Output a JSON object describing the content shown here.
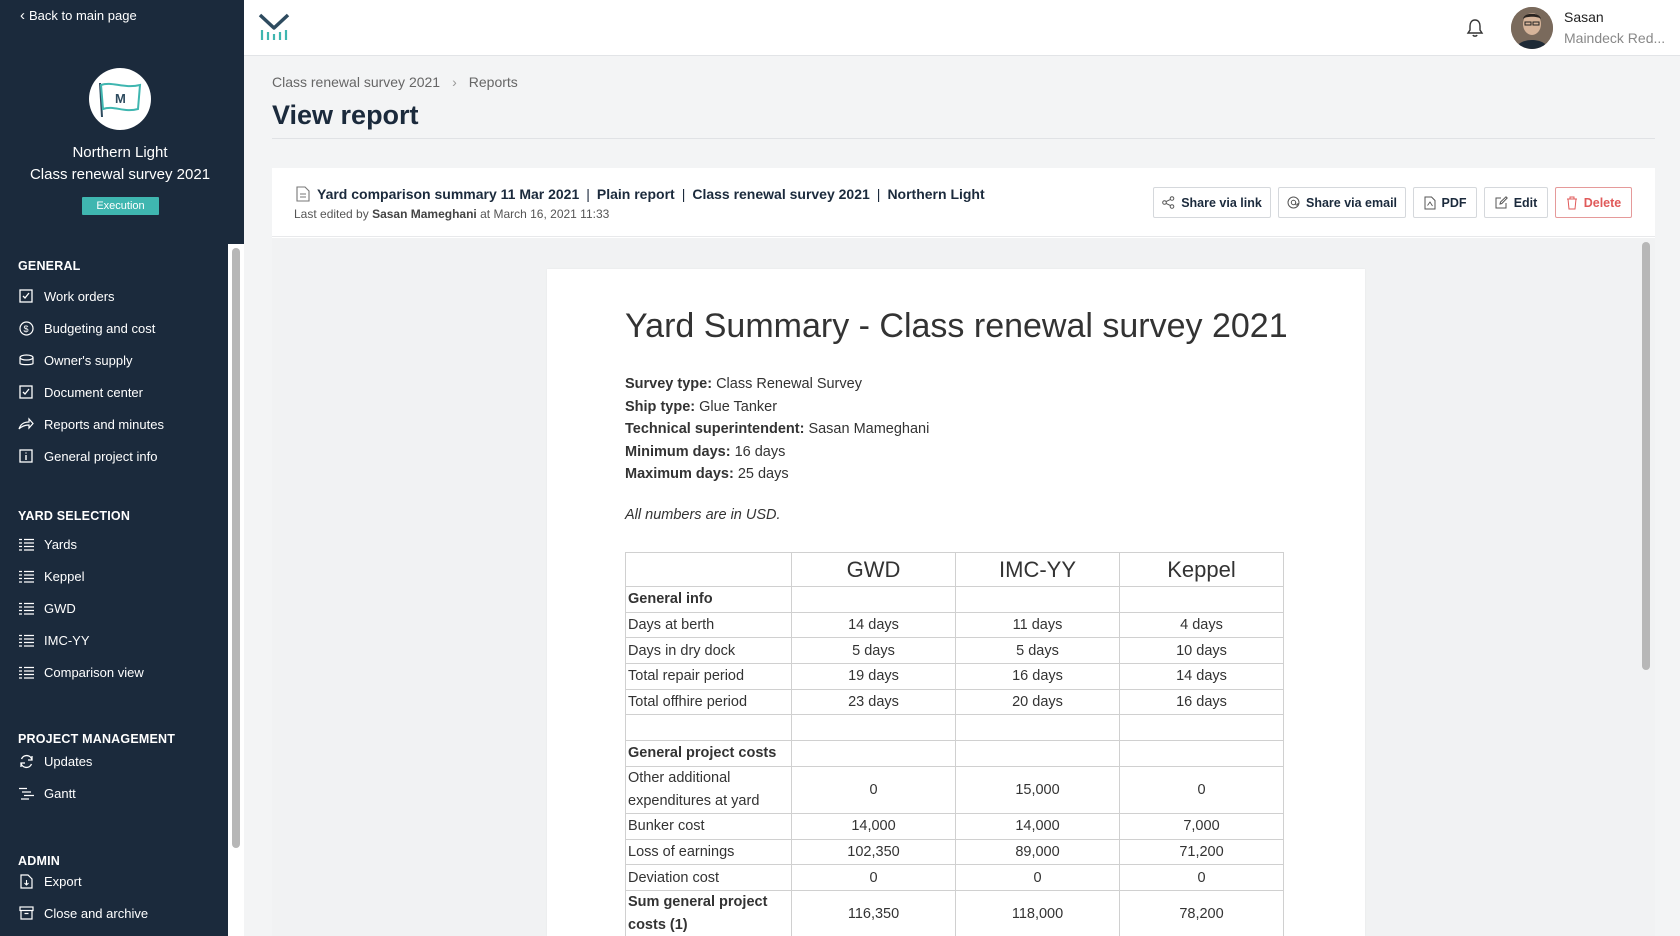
{
  "sidebar": {
    "back_label": "Back to main page",
    "vessel_name": "Northern Light",
    "project_name": "Class renewal survey 2021",
    "stage": "Execution",
    "sections": {
      "general": {
        "title": "GENERAL",
        "items": [
          "Work orders",
          "Budgeting and cost",
          "Owner's supply",
          "Document center",
          "Reports and minutes",
          "General project info"
        ]
      },
      "yard_selection": {
        "title": "YARD SELECTION",
        "items": [
          "Yards",
          "Keppel",
          "GWD",
          "IMC-YY",
          "Comparison view"
        ]
      },
      "project_management": {
        "title": "PROJECT MANAGEMENT",
        "items": [
          "Updates",
          "Gantt"
        ]
      },
      "admin": {
        "title": "ADMIN",
        "items": [
          "Export",
          "Close and archive"
        ]
      }
    },
    "icons": {
      "work_orders": "checkbox-icon",
      "budgeting": "dollar-circle-icon",
      "owners_supply": "database-icon",
      "document_center": "checkbox-icon",
      "reports": "share-arrow-icon",
      "general_info": "info-square-icon",
      "list": "list-icon",
      "updates": "refresh-icon",
      "gantt": "gantt-icon",
      "export": "file-export-icon",
      "archive": "archive-icon"
    }
  },
  "topbar": {
    "user_name": "Sasan",
    "user_company": "Maindeck Red..."
  },
  "breadcrumb": [
    "Class renewal survey 2021",
    "Reports"
  ],
  "page_title": "View report",
  "report": {
    "name": "Yard comparison summary 11 Mar 2021",
    "type": "Plain report",
    "project": "Class renewal survey 2021",
    "vessel": "Northern Light",
    "last_edited_prefix": "Last edited by",
    "last_edited_by": "Sasan Mameghani",
    "last_edited_at": "at March 16, 2021 11:33"
  },
  "actions": {
    "share_link": "Share via link",
    "share_email": "Share via email",
    "pdf": "PDF",
    "edit": "Edit",
    "delete": "Delete"
  },
  "document": {
    "title": "Yard Summary - Class renewal survey 2021",
    "fields": [
      {
        "label": "Survey type:",
        "value": "Class Renewal Survey"
      },
      {
        "label": "Ship type:",
        "value": "Glue Tanker"
      },
      {
        "label": "Technical superintendent:",
        "value": "Sasan Mameghani"
      },
      {
        "label": "Minimum days:",
        "value": "16 days"
      },
      {
        "label": "Maximum days:",
        "value": "25 days"
      }
    ],
    "note": "All numbers are in USD.",
    "table": {
      "columns": [
        "GWD",
        "IMC-YY",
        "Keppel"
      ],
      "group_general": "General info",
      "rows_general": [
        {
          "label": "Days at berth",
          "values": [
            "14 days",
            "11 days",
            "4 days"
          ]
        },
        {
          "label": "Days in dry dock",
          "values": [
            "5 days",
            "5 days",
            "10 days"
          ]
        },
        {
          "label": "Total repair period",
          "values": [
            "19 days",
            "16 days",
            "14 days"
          ]
        },
        {
          "label": "Total offhire period",
          "values": [
            "23 days",
            "20 days",
            "16 days"
          ]
        }
      ],
      "group_costs": "General project costs",
      "rows_costs": [
        {
          "label": "Other additional expenditures at yard",
          "values": [
            "0",
            "15,000",
            "0"
          ]
        },
        {
          "label": "Bunker cost",
          "values": [
            "14,000",
            "14,000",
            "7,000"
          ]
        },
        {
          "label": "Loss of earnings",
          "values": [
            "102,350",
            "89,000",
            "71,200"
          ]
        },
        {
          "label": "Deviation cost",
          "values": [
            "0",
            "0",
            "0"
          ]
        },
        {
          "label": "Sum general project costs (1)",
          "values": [
            "116,350",
            "118,000",
            "78,200"
          ]
        }
      ]
    }
  }
}
